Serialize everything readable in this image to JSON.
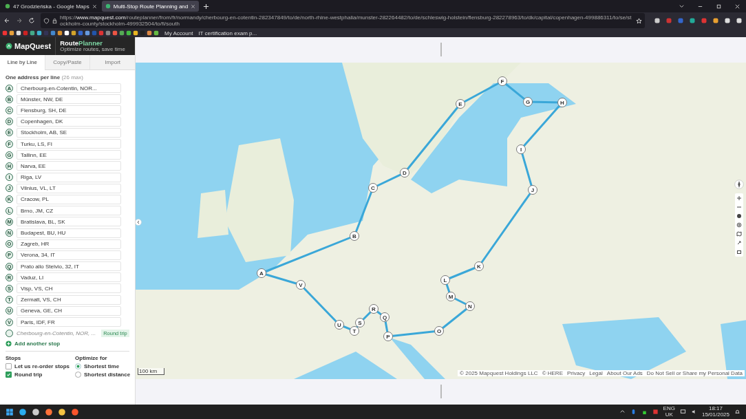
{
  "browser": {
    "tabs": [
      {
        "title": "47 Grodzieńska - Google Maps",
        "selected": false
      },
      {
        "title": "Multi-Stop Route Planning and",
        "selected": true
      }
    ],
    "url": {
      "scheme": "https://",
      "domain": "www.mapquest.com",
      "path": "/routeplanner/from/fr/normandy/cherbourg-en-cotentin-282347849/to/de/north-rhine-westphalia/munster-282264482/to/de/schleswig-holstein/flensburg-282278963/to/dk/capital/copenhagen-499886311/to/se/stockholm-county/stockholm-499932504/to/fi/south"
    },
    "bookmarks": [
      {
        "label": "My Account"
      },
      {
        "label": "IT certification exam p..."
      }
    ]
  },
  "sidebar": {
    "brand": "MapQuest",
    "product": {
      "primary": "Route",
      "accent": "Planner"
    },
    "tagline": "Optimize routes, save time",
    "tabs": [
      {
        "label": "Line by Line",
        "selected": true
      },
      {
        "label": "Copy/Paste",
        "selected": false
      },
      {
        "label": "Import",
        "selected": false
      }
    ],
    "instruction": {
      "text": "One address per line",
      "hint": "(26 max)"
    },
    "stops": [
      {
        "marker": "A",
        "address": "Cherbourg-en-Cotentin, NOR..."
      },
      {
        "marker": "B",
        "address": "Münster, NW, DE"
      },
      {
        "marker": "C",
        "address": "Flensburg, SH, DE"
      },
      {
        "marker": "D",
        "address": "Copenhagen, DK"
      },
      {
        "marker": "E",
        "address": "Stockholm, AB, SE"
      },
      {
        "marker": "F",
        "address": "Turku, LS, FI"
      },
      {
        "marker": "G",
        "address": "Tallinn, EE"
      },
      {
        "marker": "H",
        "address": "Narva, EE"
      },
      {
        "marker": "I",
        "address": "Riga, LV"
      },
      {
        "marker": "J",
        "address": "Vilnius, VL, LT"
      },
      {
        "marker": "K",
        "address": "Cracow, PL"
      },
      {
        "marker": "L",
        "address": "Brno, JM, CZ"
      },
      {
        "marker": "M",
        "address": "Bratislava, BL, SK"
      },
      {
        "marker": "N",
        "address": "Budapest, BU, HU"
      },
      {
        "marker": "O",
        "address": "Zagreb, HR"
      },
      {
        "marker": "P",
        "address": "Verona, 34, IT"
      },
      {
        "marker": "Q",
        "address": "Prato allo Stelvio, 32, IT"
      },
      {
        "marker": "R",
        "address": "Vaduz, LI"
      },
      {
        "marker": "S",
        "address": "Visp, VS, CH"
      },
      {
        "marker": "T",
        "address": "Zermatt, VS, CH"
      },
      {
        "marker": "U",
        "address": "Geneva, GE, CH"
      },
      {
        "marker": "V",
        "address": "Paris, IDF, FR"
      }
    ],
    "return_stop": {
      "address": "Cherbourg-en-Cotentin, NOR, ...",
      "badge": "Round trip"
    },
    "add_stop": "Add another stop",
    "stops_options": {
      "heading": "Stops",
      "checkboxes": [
        {
          "label": "Let us re-order stops",
          "checked": false
        },
        {
          "label": "Round trip",
          "checked": true
        }
      ]
    },
    "optimize": {
      "heading": "Optimize for",
      "radios": [
        {
          "label": "Shortest time",
          "selected": true
        },
        {
          "label": "Shortest distance",
          "selected": false
        }
      ]
    }
  },
  "map": {
    "pins": [
      {
        "label": "A"
      },
      {
        "label": "B"
      },
      {
        "label": "C"
      },
      {
        "label": "D"
      },
      {
        "label": "E"
      },
      {
        "label": "F"
      },
      {
        "label": "G"
      },
      {
        "label": "H"
      },
      {
        "label": "I"
      },
      {
        "label": "J"
      },
      {
        "label": "K"
      },
      {
        "label": "L"
      },
      {
        "label": "M"
      },
      {
        "label": "N"
      },
      {
        "label": "O"
      },
      {
        "label": "P"
      },
      {
        "label": "Q"
      },
      {
        "label": "R"
      },
      {
        "label": "S"
      },
      {
        "label": "T"
      },
      {
        "label": "U"
      },
      {
        "label": "V"
      }
    ],
    "scale": "100 km",
    "attribution": [
      "© 2025 Mapquest Holdings LLC",
      "© HERE",
      "Privacy",
      "Legal",
      "About Our Ads",
      "Do Not Sell or Share my Personal Data"
    ]
  },
  "taskbar": {
    "language": "ENG",
    "region": "UK",
    "time": "18:17",
    "date": "15/01/2025"
  }
}
